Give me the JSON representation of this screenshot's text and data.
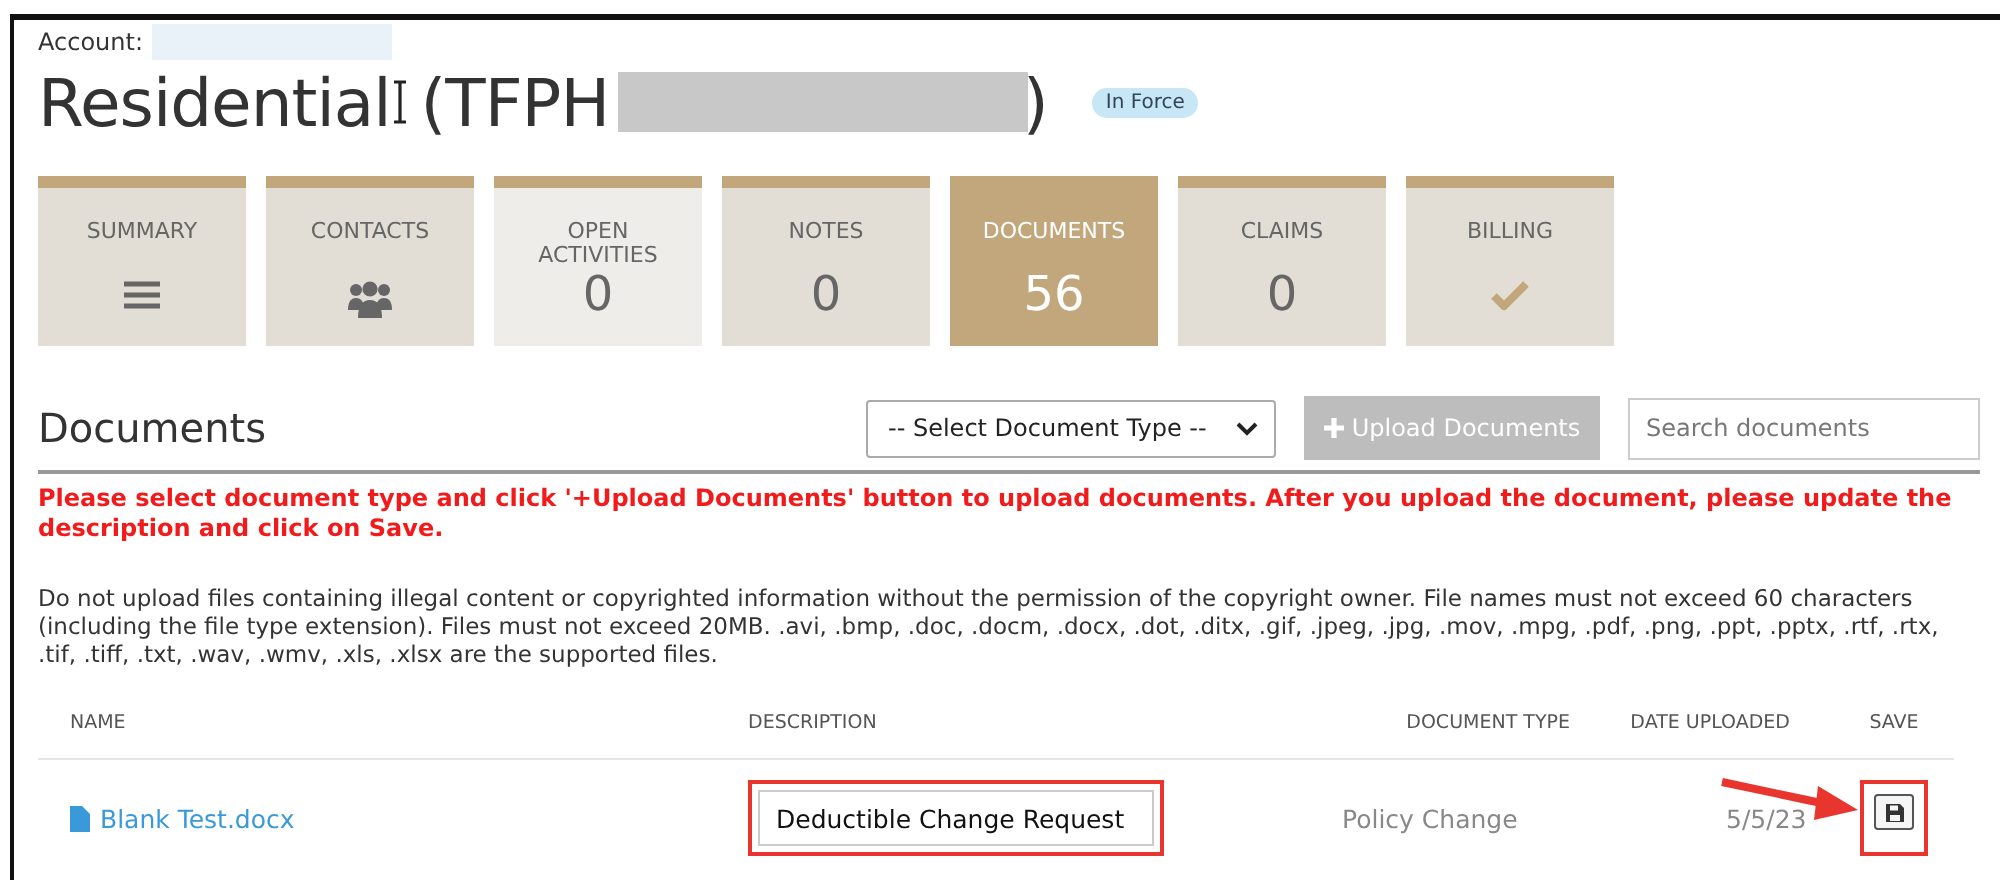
{
  "account": {
    "label": "Account:"
  },
  "policy": {
    "title": "Residential",
    "number_prefix": "(TFPH",
    "number_suffix": ")",
    "status": "In Force"
  },
  "tabs": [
    {
      "label": "SUMMARY",
      "kind": "menu",
      "selected": false,
      "highlighted": false
    },
    {
      "label": "CONTACTS",
      "kind": "people",
      "selected": false,
      "highlighted": false
    },
    {
      "label": "OPEN ACTIVITIES",
      "kind": "count",
      "count": "0",
      "selected": false,
      "highlighted": true
    },
    {
      "label": "NOTES",
      "kind": "count",
      "count": "0",
      "selected": false,
      "highlighted": false
    },
    {
      "label": "DOCUMENTS",
      "kind": "count",
      "count": "56",
      "selected": true,
      "highlighted": false
    },
    {
      "label": "CLAIMS",
      "kind": "count",
      "count": "0",
      "selected": false,
      "highlighted": false
    },
    {
      "label": "BILLING",
      "kind": "check",
      "selected": false,
      "highlighted": false
    }
  ],
  "documents": {
    "heading": "Documents",
    "type_select": "-- Select Document Type --",
    "upload_button": "Upload Documents",
    "upload_disabled": true,
    "search": {
      "placeholder": "Search documents"
    },
    "instruction": "Please select document type and click '+Upload Documents' button to upload documents. After you upload the document, please update the description and click on Save.",
    "note": "Do not upload files containing illegal content or copyrighted information without the permission of the copyright owner. File names must not exceed 60 characters (including the file type extension). Files must not exceed 20MB. .avi, .bmp, .doc, .docm, .docx, .dot, .ditx, .gif, .jpeg, .jpg, .mov, .mpg, .pdf, .png, .ppt, .pptx, .rtf, .rtx, .tif, .tiff, .txt, .wav, .wmv, .xls, .xlsx are the supported files.",
    "table": {
      "columns": [
        "NAME",
        "DESCRIPTION",
        "DOCUMENT TYPE",
        "DATE UPLOADED",
        "SAVE"
      ],
      "rows": [
        {
          "name": "Blank Test.docx",
          "description": "Deductible Change Request",
          "document_type": "Policy Change",
          "date_uploaded": "5/5/23"
        }
      ]
    }
  }
}
